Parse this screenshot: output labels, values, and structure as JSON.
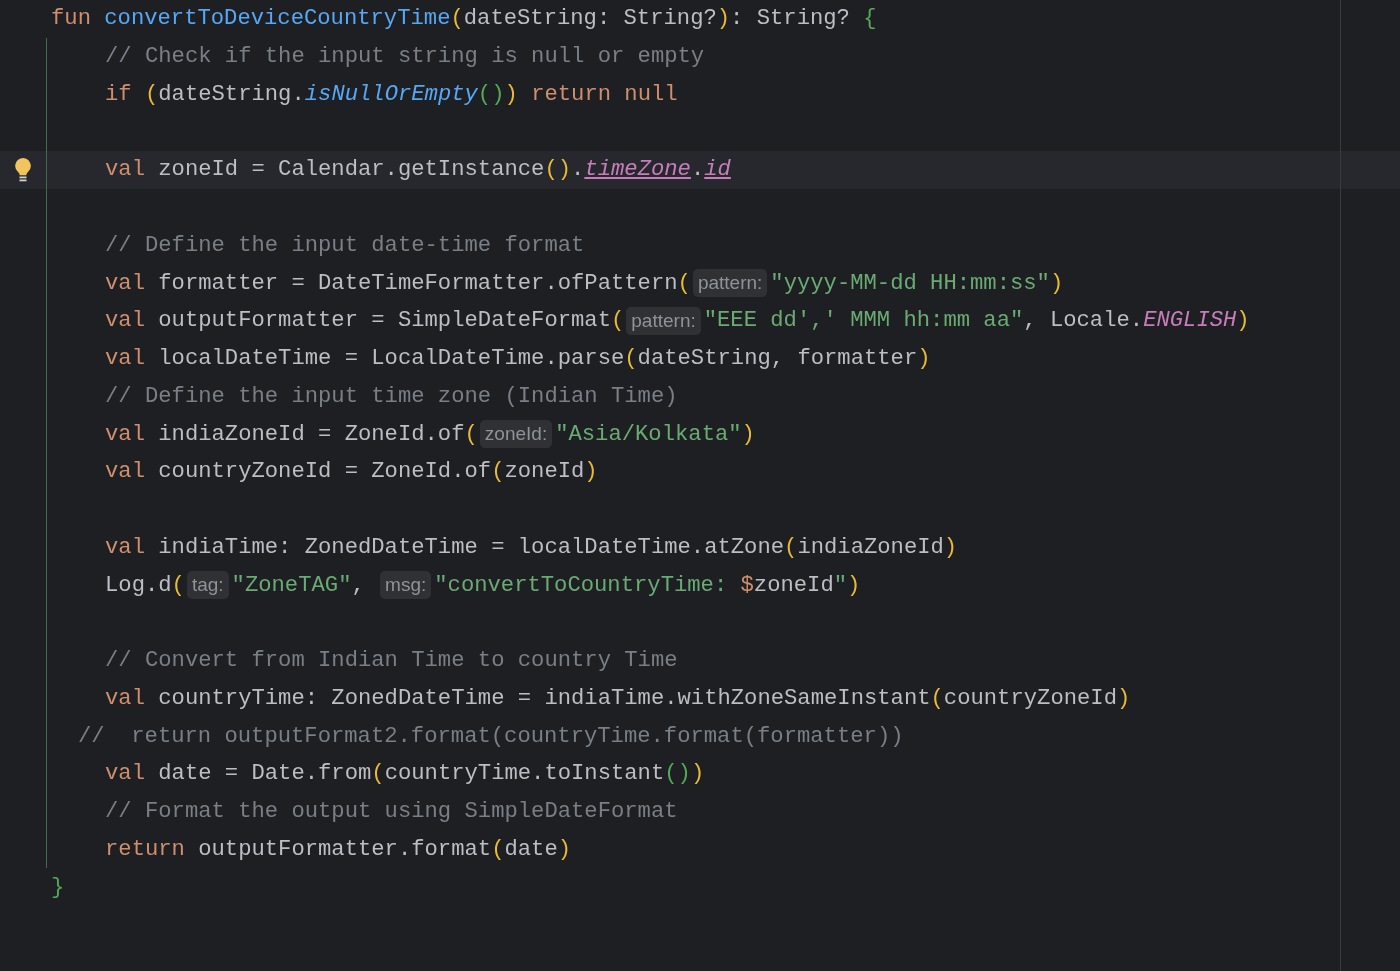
{
  "editor": {
    "lines": [
      {
        "kind": "top",
        "current": false,
        "tokens": [
          {
            "text": "fun ",
            "kind": "keyword"
          },
          {
            "text": "convertToDeviceCountryTime",
            "kind": "function"
          },
          {
            "text": "(",
            "kind": "paren"
          },
          {
            "text": "dateString: String?",
            "kind": "plain"
          },
          {
            "text": ")",
            "kind": "paren"
          },
          {
            "text": ": String? ",
            "kind": "plain"
          },
          {
            "text": "{",
            "kind": "brace"
          }
        ]
      },
      {
        "kind": "body",
        "current": false,
        "tokens": [
          {
            "text": "// Check if the input string is null or empty",
            "kind": "comment"
          }
        ]
      },
      {
        "kind": "body",
        "current": false,
        "tokens": [
          {
            "text": "if ",
            "kind": "keyword"
          },
          {
            "text": "(",
            "kind": "paren"
          },
          {
            "text": "dateString.",
            "kind": "plain"
          },
          {
            "text": "isNullOrEmpty",
            "kind": "call"
          },
          {
            "text": "()",
            "kind": "inner-paren"
          },
          {
            "text": ")",
            "kind": "paren"
          },
          {
            "text": " return null",
            "kind": "keyword"
          }
        ]
      },
      {
        "kind": "body",
        "current": false
      },
      {
        "kind": "body",
        "current": true,
        "tokens": [
          {
            "text": "val ",
            "kind": "keyword"
          },
          {
            "text": "zoneId = Calendar.getInstance",
            "kind": "plain"
          },
          {
            "text": "()",
            "kind": "paren"
          },
          {
            "text": ".",
            "kind": "plain"
          },
          {
            "text": "timeZone",
            "kind": "property"
          },
          {
            "text": ".",
            "kind": "plain"
          },
          {
            "text": "id",
            "kind": "property"
          }
        ]
      },
      {
        "kind": "body",
        "current": false
      },
      {
        "kind": "body",
        "current": false,
        "tokens": [
          {
            "text": "// Define the input date-time format",
            "kind": "comment"
          }
        ]
      },
      {
        "kind": "body",
        "current": false,
        "tokens": [
          {
            "text": "val ",
            "kind": "keyword"
          },
          {
            "text": "formatter = DateTimeFormatter.ofPattern",
            "kind": "plain"
          },
          {
            "text": "(",
            "kind": "paren"
          },
          {
            "text": "pattern:",
            "kind": "hint"
          },
          {
            "text": "\"yyyy-MM-dd HH:mm:ss\"",
            "kind": "string"
          },
          {
            "text": ")",
            "kind": "paren"
          }
        ]
      },
      {
        "kind": "body",
        "current": false,
        "tokens": [
          {
            "text": "val ",
            "kind": "keyword"
          },
          {
            "text": "outputFormatter = SimpleDateFormat",
            "kind": "plain"
          },
          {
            "text": "(",
            "kind": "paren"
          },
          {
            "text": "pattern:",
            "kind": "hint"
          },
          {
            "text": "\"EEE dd',' MMM hh:mm aa\"",
            "kind": "string"
          },
          {
            "text": ", Locale.",
            "kind": "plain"
          },
          {
            "text": "ENGLISH",
            "kind": "constant"
          },
          {
            "text": ")",
            "kind": "paren"
          }
        ]
      },
      {
        "kind": "body",
        "current": false,
        "tokens": [
          {
            "text": "val ",
            "kind": "keyword"
          },
          {
            "text": "localDateTime = LocalDateTime.parse",
            "kind": "plain"
          },
          {
            "text": "(",
            "kind": "paren"
          },
          {
            "text": "dateString, formatter",
            "kind": "plain"
          },
          {
            "text": ")",
            "kind": "paren"
          }
        ]
      },
      {
        "kind": "body",
        "current": false,
        "tokens": [
          {
            "text": "// Define the input time zone (Indian Time)",
            "kind": "comment"
          }
        ]
      },
      {
        "kind": "body",
        "current": false,
        "tokens": [
          {
            "text": "val ",
            "kind": "keyword"
          },
          {
            "text": "indiaZoneId = ZoneId.of",
            "kind": "plain"
          },
          {
            "text": "(",
            "kind": "paren"
          },
          {
            "text": "zoneId:",
            "kind": "hint"
          },
          {
            "text": "\"Asia/Kolkata\"",
            "kind": "string"
          },
          {
            "text": ")",
            "kind": "paren"
          }
        ]
      },
      {
        "kind": "body",
        "current": false,
        "tokens": [
          {
            "text": "val ",
            "kind": "keyword"
          },
          {
            "text": "countryZoneId = ZoneId.of",
            "kind": "plain"
          },
          {
            "text": "(",
            "kind": "paren"
          },
          {
            "text": "zoneId",
            "kind": "plain"
          },
          {
            "text": ")",
            "kind": "paren"
          }
        ]
      },
      {
        "kind": "body",
        "current": false
      },
      {
        "kind": "body",
        "current": false,
        "tokens": [
          {
            "text": "val ",
            "kind": "keyword"
          },
          {
            "text": "indiaTime: ZonedDateTime = localDateTime.atZone",
            "kind": "plain"
          },
          {
            "text": "(",
            "kind": "paren"
          },
          {
            "text": "indiaZoneId",
            "kind": "plain"
          },
          {
            "text": ")",
            "kind": "paren"
          }
        ]
      },
      {
        "kind": "body",
        "current": false,
        "tokens": [
          {
            "text": "Log.d",
            "kind": "plain"
          },
          {
            "text": "(",
            "kind": "paren"
          },
          {
            "text": "tag:",
            "kind": "hint"
          },
          {
            "text": "\"ZoneTAG\"",
            "kind": "string"
          },
          {
            "text": ", ",
            "kind": "plain"
          },
          {
            "text": "msg:",
            "kind": "hint"
          },
          {
            "text": "\"convertToCountryTime: ",
            "kind": "string"
          },
          {
            "text": "$",
            "kind": "keyword"
          },
          {
            "text": "zoneId",
            "kind": "plain"
          },
          {
            "text": "\"",
            "kind": "string"
          },
          {
            "text": ")",
            "kind": "paren"
          }
        ]
      },
      {
        "kind": "body",
        "current": false
      },
      {
        "kind": "body",
        "current": false,
        "tokens": [
          {
            "text": "// Convert from Indian Time to country Time",
            "kind": "comment"
          }
        ]
      },
      {
        "kind": "body",
        "current": false,
        "tokens": [
          {
            "text": "val ",
            "kind": "keyword"
          },
          {
            "text": "countryTime: ZonedDateTime = indiaTime.withZoneSameInstant",
            "kind": "plain"
          },
          {
            "text": "(",
            "kind": "paren"
          },
          {
            "text": "countryZoneId",
            "kind": "plain"
          },
          {
            "text": ")",
            "kind": "paren"
          }
        ]
      },
      {
        "kind": "commented-out",
        "current": false,
        "tokens": [
          {
            "text": "//  return outputFormat2.format(countryTime.format(formatter))",
            "kind": "comment"
          }
        ]
      },
      {
        "kind": "body",
        "current": false,
        "tokens": [
          {
            "text": "val ",
            "kind": "keyword"
          },
          {
            "text": "date = Date.from",
            "kind": "plain"
          },
          {
            "text": "(",
            "kind": "paren"
          },
          {
            "text": "countryTime.toInstant",
            "kind": "plain"
          },
          {
            "text": "()",
            "kind": "inner-paren"
          },
          {
            "text": ")",
            "kind": "paren"
          }
        ]
      },
      {
        "kind": "body",
        "current": false,
        "tokens": [
          {
            "text": "// Format the output using SimpleDateFormat",
            "kind": "comment"
          }
        ]
      },
      {
        "kind": "body",
        "current": false,
        "tokens": [
          {
            "text": "return ",
            "kind": "keyword"
          },
          {
            "text": "outputFormatter.format",
            "kind": "plain"
          },
          {
            "text": "(",
            "kind": "paren"
          },
          {
            "text": "date",
            "kind": "plain"
          },
          {
            "text": ")",
            "kind": "paren"
          }
        ]
      },
      {
        "kind": "top",
        "current": false,
        "tokens": [
          {
            "text": "}",
            "kind": "brace"
          }
        ]
      }
    ]
  }
}
